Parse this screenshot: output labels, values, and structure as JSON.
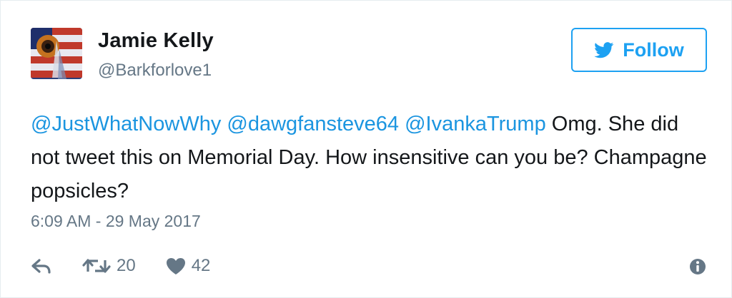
{
  "user": {
    "display_name": "Jamie Kelly",
    "screen_name": "@Barkforlove1"
  },
  "follow_button": {
    "label": "Follow"
  },
  "tweet": {
    "mentions": [
      "@JustWhatNowWhy",
      "@dawgfansteve64",
      "@IvankaTrump"
    ],
    "text_part_1": " Omg. She did not tweet this on Memorial Day. How insensitive can you be? Champagne popsicles?",
    "timestamp": "6:09 AM - 29 May 2017"
  },
  "actions": {
    "retweet_count": "20",
    "like_count": "42"
  },
  "colors": {
    "accent": "#1da1f2",
    "mention": "#1b95e0",
    "muted": "#657786",
    "text": "#14171a"
  },
  "icons": {
    "follow": "twitter-bird-icon",
    "reply": "reply-icon",
    "retweet": "retweet-icon",
    "like": "heart-icon",
    "more": "info-icon"
  }
}
